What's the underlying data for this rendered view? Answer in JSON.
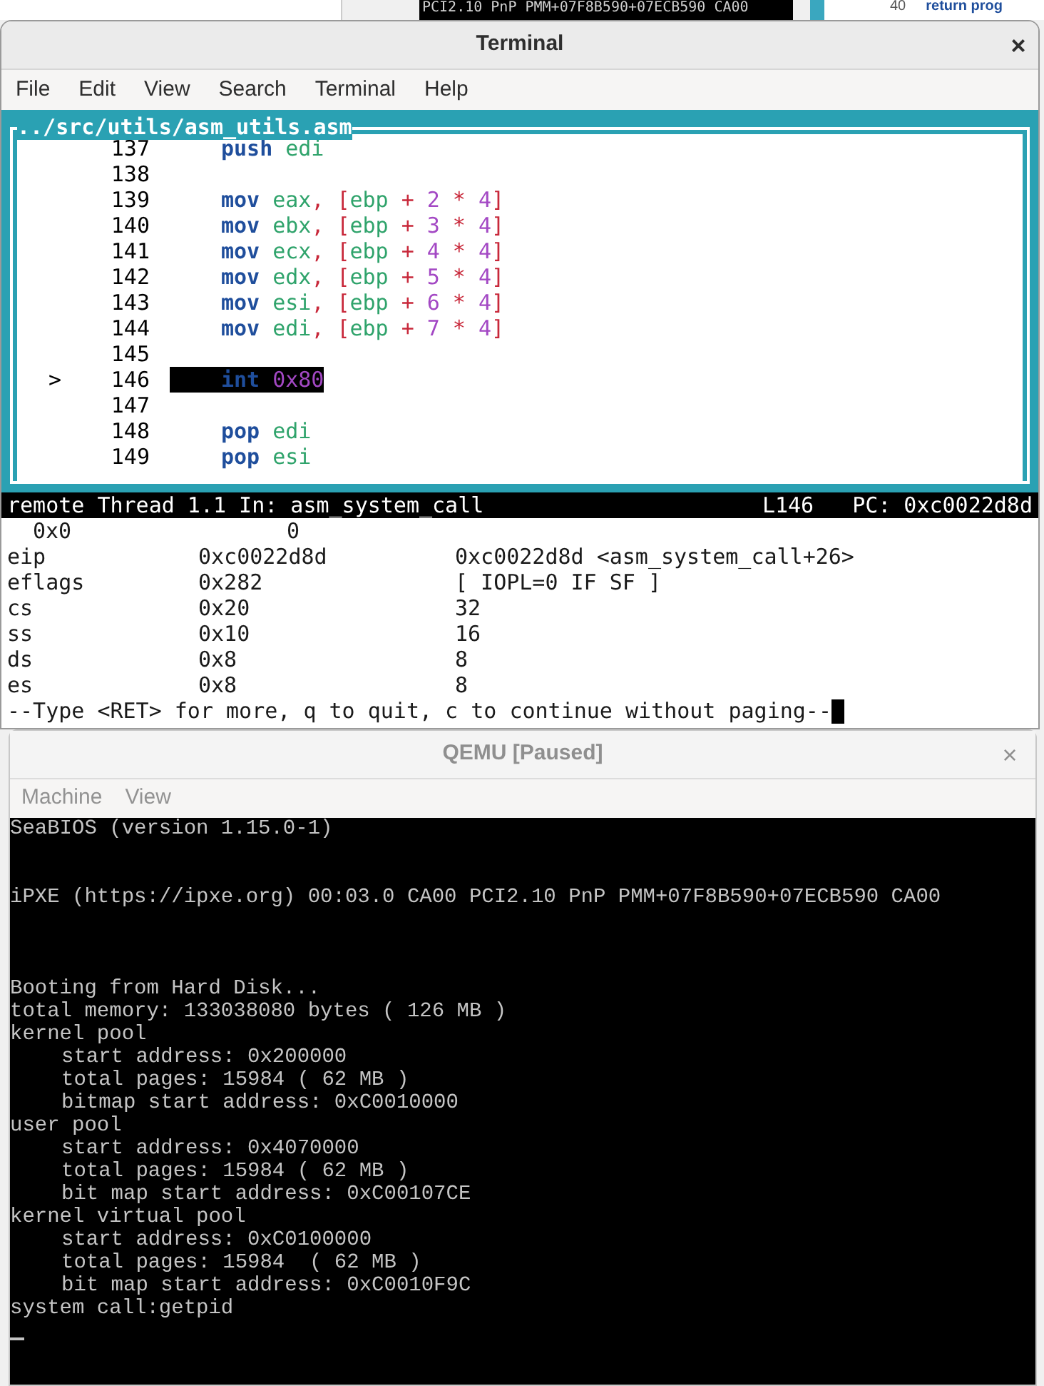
{
  "background": {
    "snippet": "PCI2.10 PnP PMM+07F8B590+07ECB590 CA00",
    "line_number": "40",
    "code": "return prog"
  },
  "terminal": {
    "title": "Terminal",
    "close": "×",
    "menu": [
      "File",
      "Edit",
      "View",
      "Search",
      "Terminal",
      "Help"
    ],
    "source": {
      "title": "../src/utils/asm_utils.asm",
      "lines": [
        {
          "number": "137",
          "current": false,
          "words": [
            [
              {
                "kind": "keyword",
                "text": "push"
              }
            ],
            [
              {
                "kind": "register",
                "text": "edi"
              }
            ]
          ]
        },
        {
          "number": "138",
          "current": false
        },
        {
          "number": "139",
          "current": false,
          "words": [
            [
              {
                "kind": "keyword",
                "text": "mov"
              }
            ],
            [
              {
                "kind": "register",
                "text": "eax"
              },
              {
                "kind": "punct",
                "text": ","
              }
            ],
            [
              {
                "kind": "punct",
                "text": "["
              },
              {
                "kind": "register",
                "text": "ebp"
              }
            ],
            [
              {
                "kind": "punct",
                "text": "+"
              }
            ],
            [
              {
                "kind": "number",
                "text": "2"
              }
            ],
            [
              {
                "kind": "punct",
                "text": "*"
              }
            ],
            [
              {
                "kind": "number",
                "text": "4"
              },
              {
                "kind": "punct",
                "text": "]"
              }
            ]
          ]
        },
        {
          "number": "140",
          "current": false,
          "words": [
            [
              {
                "kind": "keyword",
                "text": "mov"
              }
            ],
            [
              {
                "kind": "register",
                "text": "ebx"
              },
              {
                "kind": "punct",
                "text": ","
              }
            ],
            [
              {
                "kind": "punct",
                "text": "["
              },
              {
                "kind": "register",
                "text": "ebp"
              }
            ],
            [
              {
                "kind": "punct",
                "text": "+"
              }
            ],
            [
              {
                "kind": "number",
                "text": "3"
              }
            ],
            [
              {
                "kind": "punct",
                "text": "*"
              }
            ],
            [
              {
                "kind": "number",
                "text": "4"
              },
              {
                "kind": "punct",
                "text": "]"
              }
            ]
          ]
        },
        {
          "number": "141",
          "current": false,
          "words": [
            [
              {
                "kind": "keyword",
                "text": "mov"
              }
            ],
            [
              {
                "kind": "register",
                "text": "ecx"
              },
              {
                "kind": "punct",
                "text": ","
              }
            ],
            [
              {
                "kind": "punct",
                "text": "["
              },
              {
                "kind": "register",
                "text": "ebp"
              }
            ],
            [
              {
                "kind": "punct",
                "text": "+"
              }
            ],
            [
              {
                "kind": "number",
                "text": "4"
              }
            ],
            [
              {
                "kind": "punct",
                "text": "*"
              }
            ],
            [
              {
                "kind": "number",
                "text": "4"
              },
              {
                "kind": "punct",
                "text": "]"
              }
            ]
          ]
        },
        {
          "number": "142",
          "current": false,
          "words": [
            [
              {
                "kind": "keyword",
                "text": "mov"
              }
            ],
            [
              {
                "kind": "register",
                "text": "edx"
              },
              {
                "kind": "punct",
                "text": ","
              }
            ],
            [
              {
                "kind": "punct",
                "text": "["
              },
              {
                "kind": "register",
                "text": "ebp"
              }
            ],
            [
              {
                "kind": "punct",
                "text": "+"
              }
            ],
            [
              {
                "kind": "number",
                "text": "5"
              }
            ],
            [
              {
                "kind": "punct",
                "text": "*"
              }
            ],
            [
              {
                "kind": "number",
                "text": "4"
              },
              {
                "kind": "punct",
                "text": "]"
              }
            ]
          ]
        },
        {
          "number": "143",
          "current": false,
          "words": [
            [
              {
                "kind": "keyword",
                "text": "mov"
              }
            ],
            [
              {
                "kind": "register",
                "text": "esi"
              },
              {
                "kind": "punct",
                "text": ","
              }
            ],
            [
              {
                "kind": "punct",
                "text": "["
              },
              {
                "kind": "register",
                "text": "ebp"
              }
            ],
            [
              {
                "kind": "punct",
                "text": "+"
              }
            ],
            [
              {
                "kind": "number",
                "text": "6"
              }
            ],
            [
              {
                "kind": "punct",
                "text": "*"
              }
            ],
            [
              {
                "kind": "number",
                "text": "4"
              },
              {
                "kind": "punct",
                "text": "]"
              }
            ]
          ]
        },
        {
          "number": "144",
          "current": false,
          "words": [
            [
              {
                "kind": "keyword",
                "text": "mov"
              }
            ],
            [
              {
                "kind": "register",
                "text": "edi"
              },
              {
                "kind": "punct",
                "text": ","
              }
            ],
            [
              {
                "kind": "punct",
                "text": "["
              },
              {
                "kind": "register",
                "text": "ebp"
              }
            ],
            [
              {
                "kind": "punct",
                "text": "+"
              }
            ],
            [
              {
                "kind": "number",
                "text": "7"
              }
            ],
            [
              {
                "kind": "punct",
                "text": "*"
              }
            ],
            [
              {
                "kind": "number",
                "text": "4"
              },
              {
                "kind": "punct",
                "text": "]"
              }
            ]
          ]
        },
        {
          "number": "145",
          "current": false
        },
        {
          "number": "146",
          "current": true,
          "marker": ">",
          "words": [
            [
              {
                "kind": "keyword",
                "text": "int"
              }
            ],
            [
              {
                "kind": "number",
                "text": "0x80"
              }
            ]
          ]
        },
        {
          "number": "147",
          "current": false
        },
        {
          "number": "148",
          "current": false,
          "words": [
            [
              {
                "kind": "keyword",
                "text": "pop"
              }
            ],
            [
              {
                "kind": "register",
                "text": "edi"
              }
            ]
          ]
        },
        {
          "number": "149",
          "current": false,
          "words": [
            [
              {
                "kind": "keyword",
                "text": "pop"
              }
            ],
            [
              {
                "kind": "register",
                "text": "esi"
              }
            ]
          ]
        }
      ]
    },
    "status": {
      "thread": "remote Thread 1.1 In: asm_system_call",
      "line": "L146",
      "pc": "PC: 0xc0022d8d"
    },
    "registers": [
      {
        "name": "0x0",
        "hex": "0"
      },
      {
        "name": "eip",
        "hex": "0xc0022d8d",
        "natural": "0xc0022d8d <asm_system_call+26>"
      },
      {
        "name": "eflags",
        "hex": "0x282",
        "natural": "[ IOPL=0 IF SF ]"
      },
      {
        "name": "cs",
        "hex": "0x20",
        "natural": "32"
      },
      {
        "name": "ss",
        "hex": "0x10",
        "natural": "16"
      },
      {
        "name": "ds",
        "hex": "0x8",
        "natural": "8"
      },
      {
        "name": "es",
        "hex": "0x8",
        "natural": "8"
      }
    ],
    "prompt": "--Type <RET> for more, q to quit, c to continue without paging--"
  },
  "qemu": {
    "title": "QEMU [Paused]",
    "close": "×",
    "menu": [
      "Machine",
      "View"
    ],
    "screen": {
      "cursor": true,
      "blocks": [
        {
          "lines": [
            {
              "text": "SeaBIOS (version 1.15.0-1)"
            }
          ]
        },
        {
          "lines": [
            {
              "text": "iPXE (https://ipxe.org) 00:03.0 CA00 PCI2.10 PnP PMM+07F8B590+07ECB590 CA00"
            }
          ]
        },
        {
          "lines": [
            {
              "text": "Booting from Hard Disk..."
            },
            {
              "text": "total memory: 133038080 bytes ( 126 MB )"
            },
            {
              "text": "kernel pool",
              "children": [
                {
                  "text": "start address: 0x200000"
                },
                {
                  "text": "total pages: 15984 ( 62 MB )"
                },
                {
                  "text": "bitmap start address: 0xC0010000"
                }
              ]
            },
            {
              "text": "user pool",
              "children": [
                {
                  "text": "start address: 0x4070000"
                },
                {
                  "text": "total pages: 15984 ( 62 MB )"
                },
                {
                  "text": "bit map start address: 0xC00107CE"
                }
              ]
            },
            {
              "text": "kernel virtual pool",
              "children": [
                {
                  "text": "start address: 0xC0100000"
                },
                {
                  "text": "total pages: 15984  ( 62 MB )"
                },
                {
                  "text": "bit map start address: 0xC0010F9C"
                }
              ]
            },
            {
              "text": "system call:getpid"
            }
          ]
        }
      ]
    }
  }
}
